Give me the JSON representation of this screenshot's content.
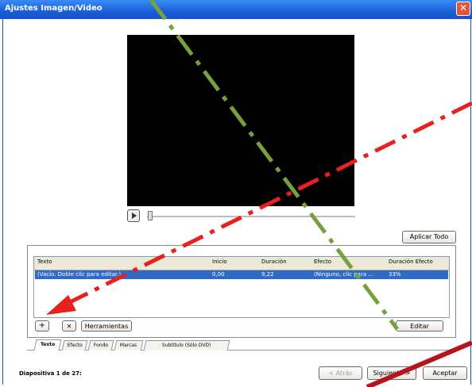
{
  "window": {
    "title": "Ajustes Imagen/Video",
    "close_label": "✕"
  },
  "player": {
    "play_icon": "play-icon"
  },
  "buttons": {
    "apply_all": "Aplicar Todo",
    "add": "+",
    "remove": "✕",
    "tools": "Herramientas",
    "edit": "Editar",
    "back": "< Atrás",
    "next": "Siguiente >",
    "accept": "Aceptar"
  },
  "grid": {
    "columns": [
      "Texto",
      "Inicio",
      "Duración",
      "Efecto",
      "Duración Efecto"
    ],
    "rows": [
      [
        "(Vacío. Doble clic para editar.)",
        "0,00",
        "9,22",
        "(Ninguno, clic para ...",
        "33%"
      ]
    ]
  },
  "tabs": [
    "Texto",
    "Efecto",
    "Fondo",
    "Marcas",
    "Subtítulo (Sólo DVD)"
  ],
  "status": {
    "slide_info": "Diapositiva 1 de 27:"
  },
  "annotation_colors": {
    "red_arrow": "#e8201e",
    "green_line": "#77a13a",
    "dark_red_line": "#b5141b"
  }
}
